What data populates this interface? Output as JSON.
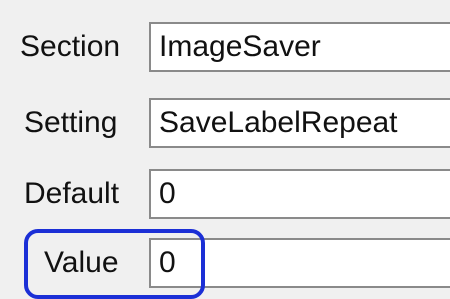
{
  "form": {
    "rows": [
      {
        "label": "Section",
        "value": "ImageSaver"
      },
      {
        "label": "Setting",
        "value": "SaveLabelRepeat"
      },
      {
        "label": "Default",
        "value": "0"
      },
      {
        "label": "Value",
        "value": "0"
      }
    ]
  },
  "highlight": {
    "color": "#1b2fd6",
    "target": "Value"
  }
}
